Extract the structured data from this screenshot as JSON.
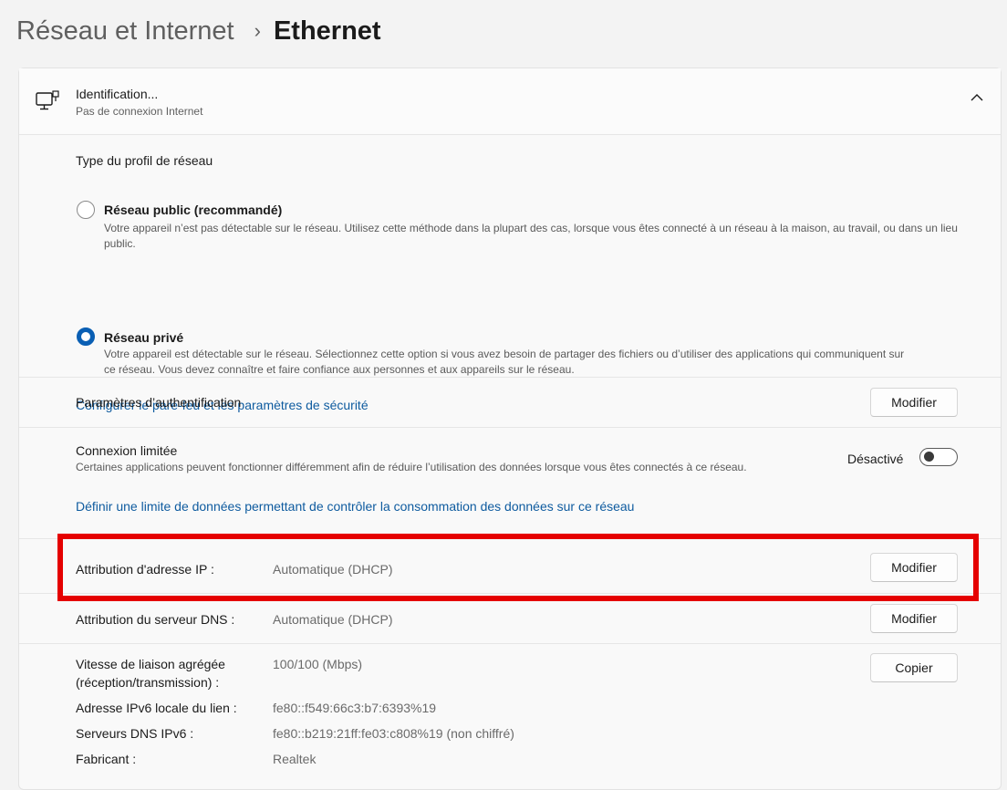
{
  "breadcrumb": {
    "parent": "Réseau et Internet",
    "separator": "›",
    "current": "Ethernet"
  },
  "network": {
    "name": "Identification...",
    "status": "Pas de connexion Internet"
  },
  "profile": {
    "heading": "Type du profil de réseau",
    "public": {
      "label": "Réseau public (recommandé)",
      "description": "Votre appareil n’est pas détectable sur le réseau. Utilisez cette méthode dans la plupart des cas, lorsque vous êtes connecté à un réseau à la maison, au travail, ou dans un lieu public.",
      "selected": false
    },
    "private": {
      "label": "Réseau privé",
      "description": "Votre appareil est détectable sur le réseau. Sélectionnez cette option si vous avez besoin de partager des fichiers ou d’utiliser des applications qui communiquent sur ce réseau. Vous devez connaître et faire confiance aux personnes et aux appareils sur le réseau.",
      "selected": true
    },
    "firewall_link": "Configurer le pare-feu et les paramètres de sécurité"
  },
  "auth": {
    "label": "Paramètres d’authentification",
    "button": "Modifier"
  },
  "metered": {
    "label": "Connexion limitée",
    "description": "Certaines applications peuvent fonctionner différemment afin de réduire l’utilisation des données lorsque vous êtes connectés à ce réseau.",
    "state_label": "Désactivé",
    "enabled": false,
    "limit_link": "Définir une limite de données permettant de contrôler la consommation des données sur ce réseau"
  },
  "ip": {
    "label": "Attribution d'adresse IP :",
    "value": "Automatique (DHCP)",
    "button": "Modifier"
  },
  "dns": {
    "label": "Attribution du serveur DNS :",
    "value": "Automatique (DHCP)",
    "button": "Modifier"
  },
  "properties": {
    "copy_button": "Copier",
    "speed_label_1": "Vitesse de liaison agrégée",
    "speed_label_2": "(réception/transmission) :",
    "speed_value": "100/100 (Mbps)",
    "ipv6_label": "Adresse IPv6 locale du lien :",
    "ipv6_value": "fe80::f549:66c3:b7:6393%19",
    "dns6_label": "Serveurs DNS IPv6 :",
    "dns6_value": "fe80::b219:21ff:fe03:c808%19 (non chiffré)",
    "maker_label": "Fabricant :",
    "maker_value": "Realtek"
  },
  "colors": {
    "accent": "#0a5fb4",
    "link": "#0e5b9f",
    "highlight": "#e50000"
  }
}
